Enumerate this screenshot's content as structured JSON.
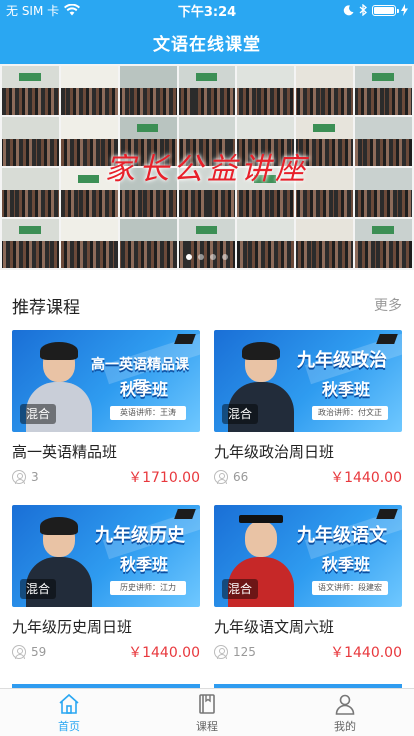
{
  "status": {
    "carrier": "无 SIM 卡",
    "time": "下午3:24",
    "wifi_icon": "wifi-icon",
    "battery_icon": "battery-icon"
  },
  "nav": {
    "title": "文语在线课堂"
  },
  "banner": {
    "caption": "家长公益讲座",
    "slide_count": 4,
    "active_slide": 1
  },
  "section": {
    "title": "推荐课程",
    "more": "更多"
  },
  "courses": [
    {
      "name": "高一英语精品班",
      "students": "3",
      "price": "￥1710.00",
      "badge": "混合",
      "thumb_title": "高一英语精品课程",
      "thumb_season": "秋季班",
      "thumb_teacher": "英语讲师：王涛",
      "teacher_style": "light"
    },
    {
      "name": "九年级政治周日班",
      "students": "66",
      "price": "￥1440.00",
      "badge": "混合",
      "thumb_title": "九年级政治",
      "thumb_season": "秋季班",
      "thumb_teacher": "政治讲师：付文正",
      "teacher_style": "dark"
    },
    {
      "name": "九年级历史周日班",
      "students": "59",
      "price": "￥1440.00",
      "badge": "混合",
      "thumb_title": "九年级历史",
      "thumb_season": "秋季班",
      "thumb_teacher": "历史讲师：江力",
      "teacher_style": "dark"
    },
    {
      "name": "九年级语文周六班",
      "students": "125",
      "price": "￥1440.00",
      "badge": "混合",
      "thumb_title": "九年级语文",
      "thumb_season": "秋季班",
      "thumb_teacher": "语文讲师：段建宏",
      "teacher_style": "gown"
    }
  ],
  "tabs": [
    {
      "label": "首页",
      "icon": "home-icon",
      "active": true
    },
    {
      "label": "课程",
      "icon": "book-icon",
      "active": false
    },
    {
      "label": "我的",
      "icon": "profile-icon",
      "active": false
    }
  ],
  "colors": {
    "brand": "#2aa7f2",
    "price": "#e8383d",
    "muted": "#999999"
  }
}
